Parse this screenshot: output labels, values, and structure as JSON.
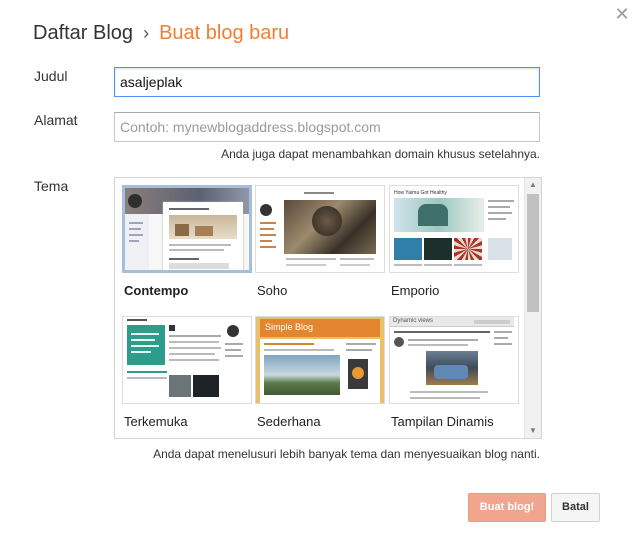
{
  "header": {
    "root": "Daftar Blog",
    "separator": "›",
    "current": "Buat blog baru"
  },
  "form": {
    "title_label": "Judul",
    "title_value": "asaljeplak",
    "address_label": "Alamat",
    "address_placeholder": "Contoh: mynewblogaddress.blogspot.com",
    "address_hint": "Anda juga dapat menambahkan domain khusus setelahnya.",
    "theme_label": "Tema",
    "theme_hint": "Anda dapat menelusuri lebih banyak tema dan menyesuaikan blog nanti."
  },
  "themes": [
    {
      "name": "Contempo",
      "selected": true
    },
    {
      "name": "Soho",
      "selected": false
    },
    {
      "name": "Emporio",
      "selected": false
    },
    {
      "name": "Terkemuka",
      "selected": false
    },
    {
      "name": "Sederhana",
      "selected": false
    },
    {
      "name": "Tampilan Dinamis",
      "selected": false
    }
  ],
  "thumbnail_text": {
    "emporio": "How Yaima Got Healthy",
    "sederhana": "Simple Blog",
    "dynamic": "Dynamic views"
  },
  "buttons": {
    "create": "Buat blog!",
    "cancel": "Batal"
  },
  "icons": {
    "close": "close-icon",
    "scroll_up": "scroll-up-arrow",
    "scroll_down": "scroll-down-arrow"
  },
  "colors": {
    "accent": "#f57d31",
    "primary_button": "#f2a58e",
    "focus_border": "#4d90fe",
    "selected_border": "#a6bedb"
  }
}
